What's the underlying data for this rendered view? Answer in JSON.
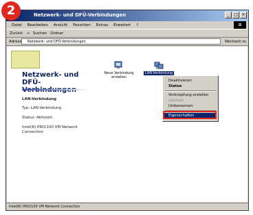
{
  "badge": {
    "number": "2"
  },
  "window": {
    "title": "Netzwerk- und DFÜ-Verbindungen",
    "controls": [
      "_",
      "□",
      "×"
    ]
  },
  "menubar": [
    "Datei",
    "Bearbeiten",
    "Ansicht",
    "Favoriten",
    "Extras",
    "Erweitert",
    "?"
  ],
  "toolbar": [
    "Zurück",
    "→",
    "Suchen",
    "Ordner"
  ],
  "address": {
    "label": "Adresse",
    "value": "Netzwerk- und DFÜ-Verbindungen",
    "go": "Wechseln zu"
  },
  "leftpane": {
    "title": "Netzwerk- und DFÜ-Verbindungen",
    "conn_title": "LAN-Verbindung",
    "type": "Typ: LAN-Verbindung",
    "status": "Status: Aktiviert",
    "device": "Intel(R) PRO/100 VM Network Connection"
  },
  "icons": [
    {
      "label": "Neue Verbindung erstellen"
    },
    {
      "label": "LAN-Verbindung"
    }
  ],
  "context_menu": [
    "Deaktivieren",
    "Status",
    "Verknüpfung erstellen",
    "Löschen",
    "Umbenennen",
    "Eigenschaften"
  ],
  "statusbar": {
    "text": "Intel(R) PRO/100 VM Network Connection"
  },
  "colors": {
    "accent": "#e0281e",
    "title": "#0a246a"
  }
}
